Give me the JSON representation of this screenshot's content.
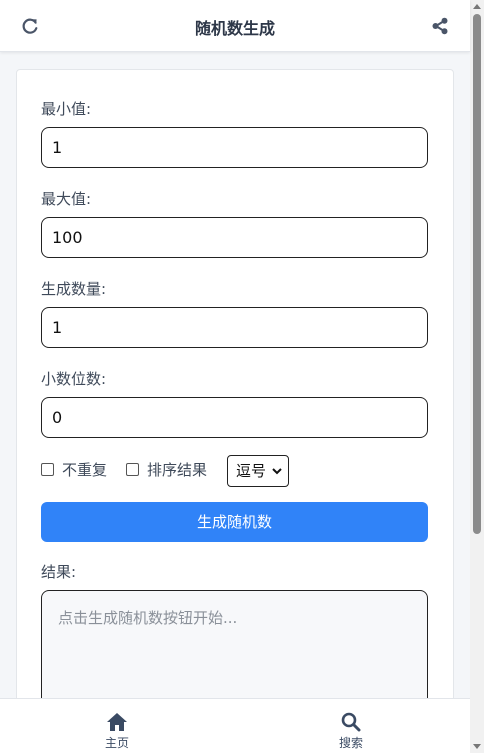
{
  "header": {
    "title": "随机数生成",
    "refresh_icon": "refresh-icon",
    "share_icon": "share-icon"
  },
  "form": {
    "min_label": "最小值:",
    "min_value": "1",
    "max_label": "最大值:",
    "max_value": "100",
    "count_label": "生成数量:",
    "count_value": "1",
    "decimals_label": "小数位数:",
    "decimals_value": "0",
    "no_repeat_label": "不重复",
    "sort_label": "排序结果",
    "separator_selected": "逗号",
    "generate_button": "生成随机数",
    "result_label": "结果:",
    "result_placeholder": "点击生成随机数按钮开始..."
  },
  "nav": {
    "home_label": "主页",
    "search_label": "搜索"
  },
  "colors": {
    "accent": "#3083f8",
    "nav_text": "#3a4a63"
  }
}
